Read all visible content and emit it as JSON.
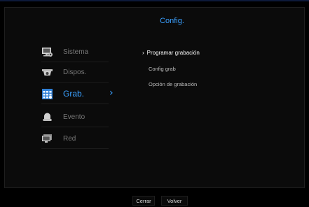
{
  "header": {
    "title": "Config."
  },
  "sidebar": {
    "items": [
      {
        "label": "Sistema",
        "icon": "system-settings-icon"
      },
      {
        "label": "Dispos.",
        "icon": "camera-device-icon"
      },
      {
        "label": "Grab.",
        "icon": "recording-grid-icon",
        "active": true
      },
      {
        "label": "Evento",
        "icon": "event-alarm-icon"
      },
      {
        "label": "Red",
        "icon": "network-monitor-icon"
      }
    ],
    "active_indicator": "›"
  },
  "submenu": {
    "selected_caret": "›",
    "items": [
      {
        "label": "Programar grabación",
        "selected": true
      },
      {
        "label": "Config grab"
      },
      {
        "label": "Opción de grabación"
      }
    ]
  },
  "footer": {
    "close_label": "Cerrar",
    "back_label": "Volver"
  },
  "colors": {
    "accent": "#3aa0ff",
    "background": "#000000",
    "text_dim": "#777777"
  }
}
